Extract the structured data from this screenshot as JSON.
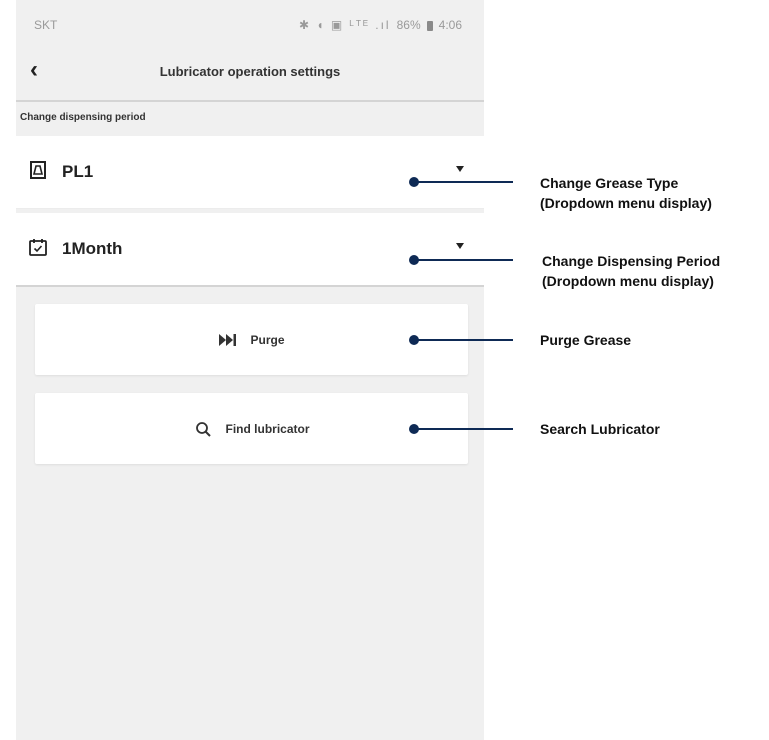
{
  "status_bar": {
    "carrier": "SKT",
    "icons": "✱ ◖ ▣ ᴸᵀᴱ .ıl",
    "battery": "86%",
    "time": "4:06"
  },
  "app_bar": {
    "title": "Lubricator operation settings"
  },
  "section": {
    "label": "Change dispensing period"
  },
  "grease_dropdown": {
    "value": "PL1"
  },
  "period_dropdown": {
    "value": "1Month"
  },
  "purge_button": {
    "label": "Purge"
  },
  "find_button": {
    "label": "Find lubricator"
  },
  "annotations": {
    "grease_line1": "Change Grease Type",
    "grease_line2": "(Dropdown menu display)",
    "period_line1": "Change Dispensing Period",
    "period_line2": "(Dropdown menu display)",
    "purge": "Purge Grease",
    "search": "Search Lubricator"
  },
  "colors": {
    "annotation": "#0e2a55",
    "background": "#f0f0f0"
  }
}
